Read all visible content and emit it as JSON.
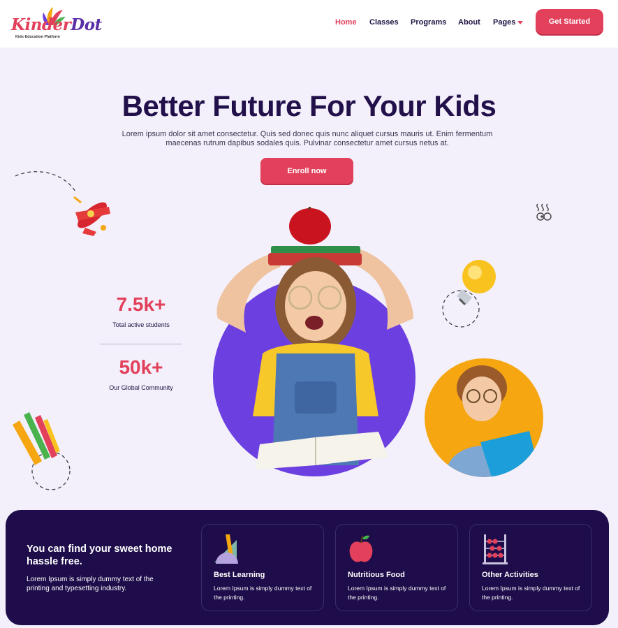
{
  "brand": {
    "name_main": "Kinder",
    "name_accent": "Dot",
    "tagline": "Kids Education Platform"
  },
  "nav": {
    "items": [
      "Home",
      "Classes",
      "Programs",
      "About",
      "Pages"
    ],
    "active": "Home",
    "cta": "Get Started"
  },
  "hero": {
    "title": "Better Future For Your Kids",
    "description": "Lorem ipsum dolor sit amet consectetur. Quis sed donec quis nunc aliquet cursus mauris ut. Enim fermentum maecenas rutrum dapibus sodales quis. Pulvinar consectetur amet cursus netus at.",
    "cta": "Enroll now"
  },
  "stats": [
    {
      "value": "7.5k+",
      "label": "Total active students"
    },
    {
      "value": "50k+",
      "label": "Our Global Community"
    }
  ],
  "features": {
    "heading": "You can find your sweet home hassle free.",
    "text": "Lorem Ipsum is simply dummy text of the printing and typesetting industry.",
    "cards": [
      {
        "icon": "geometry-tools-icon",
        "title": "Best Learning",
        "text": "Lorem Ipsum is simply dummy text of the printing."
      },
      {
        "icon": "apple-icon",
        "title": "Nutritious Food",
        "text": "Lorem Ipsum is simply dummy text of the printing."
      },
      {
        "icon": "abacus-icon",
        "title": "Other Activities",
        "text": "Lorem Ipsum is simply dummy text of the printing."
      }
    ]
  },
  "colors": {
    "accent": "#e2405b",
    "dark": "#1e0d4a",
    "purple": "#6c3fe0",
    "orange": "#f5a611",
    "background": "#f3f0fb"
  }
}
